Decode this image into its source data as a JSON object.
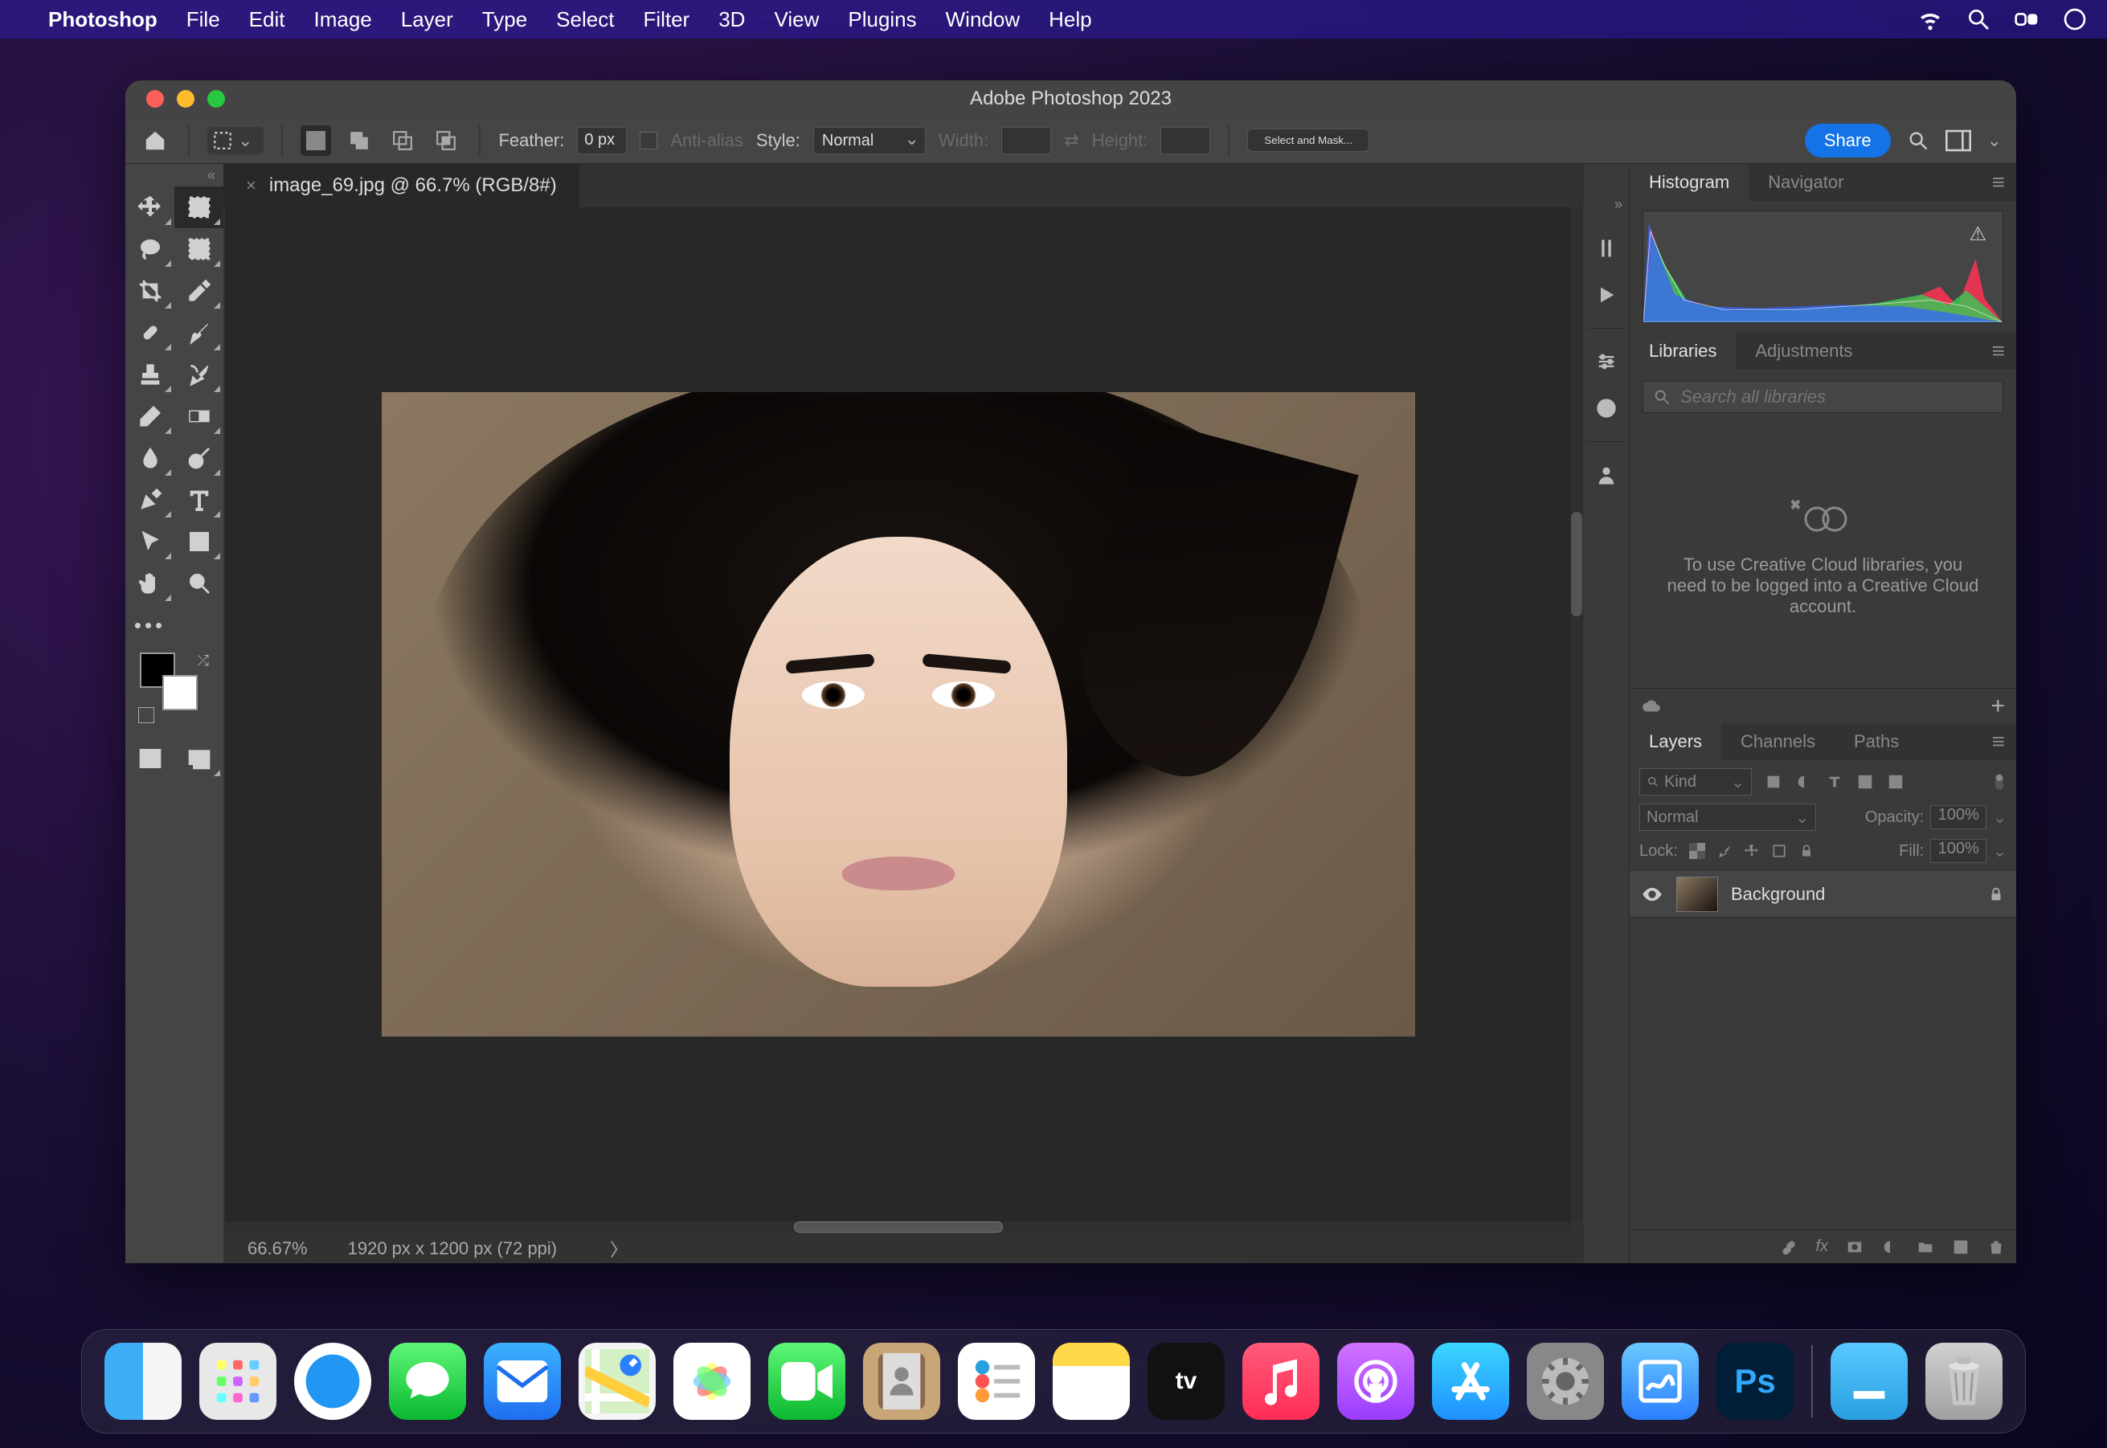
{
  "menubar": {
    "app": "Photoshop",
    "items": [
      "File",
      "Edit",
      "Image",
      "Layer",
      "Type",
      "Select",
      "Filter",
      "3D",
      "View",
      "Plugins",
      "Window",
      "Help"
    ]
  },
  "window": {
    "title": "Adobe Photoshop 2023"
  },
  "options": {
    "feather_label": "Feather:",
    "feather_value": "0 px",
    "antialias_label": "Anti-alias",
    "style_label": "Style:",
    "style_value": "Normal",
    "width_label": "Width:",
    "width_value": "",
    "height_label": "Height:",
    "height_value": "",
    "mask_btn": "Select and Mask...",
    "share_btn": "Share"
  },
  "document": {
    "tab_title": "image_69.jpg @ 66.7% (RGB/8#)",
    "zoom": "66.67%",
    "info": "1920 px x 1200 px (72 ppi)"
  },
  "panels": {
    "histogram_tab": "Histogram",
    "navigator_tab": "Navigator",
    "libraries_tab": "Libraries",
    "adjustments_tab": "Adjustments",
    "lib_search_placeholder": "Search all libraries",
    "lib_empty": "To use Creative Cloud libraries, you need to be logged into a Creative Cloud account.",
    "layers_tab": "Layers",
    "channels_tab": "Channels",
    "paths_tab": "Paths",
    "kind_label": "Kind",
    "blend_value": "Normal",
    "opacity_label": "Opacity:",
    "opacity_value": "100%",
    "lock_label": "Lock:",
    "fill_label": "Fill:",
    "fill_value": "100%",
    "layer0_name": "Background"
  },
  "dock": {
    "items": [
      "finder",
      "launchpad",
      "safari",
      "messages",
      "mail",
      "maps",
      "photos",
      "facetime",
      "contacts",
      "reminders",
      "notes",
      "tv",
      "music",
      "podcasts",
      "appstore",
      "settings",
      "freeform",
      "photoshop"
    ],
    "right": [
      "downloads",
      "trash"
    ],
    "ps_label": "Ps"
  }
}
